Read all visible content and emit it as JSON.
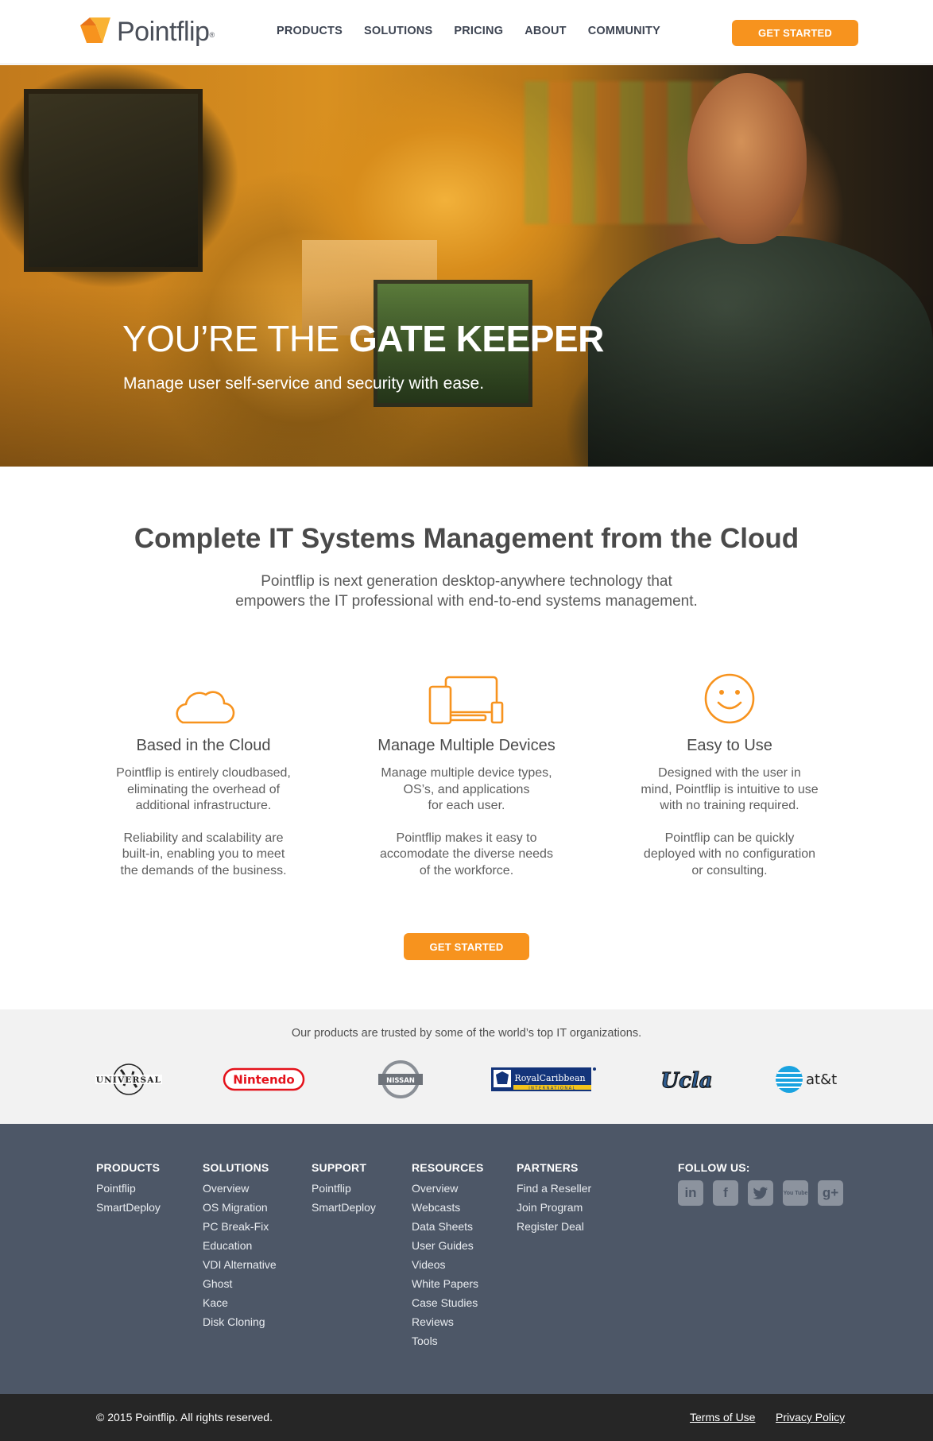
{
  "header": {
    "logo_text": "Pointflip",
    "logo_mark": "®",
    "nav": [
      "PRODUCTS",
      "SOLUTIONS",
      "PRICING",
      "ABOUT",
      "COMMUNITY"
    ],
    "cta": "GET STARTED"
  },
  "hero": {
    "title_light": "YOU’RE THE ",
    "title_bold": "GATE KEEPER",
    "subtitle": "Manage user self-service and security with ease."
  },
  "intro": {
    "title": "Complete IT Systems Management from the Cloud",
    "text_line1": "Pointflip is next generation desktop-anywhere technology that",
    "text_line2": "empowers the IT professional with end-to-end systems management."
  },
  "features": [
    {
      "icon": "cloud-icon",
      "title": "Based in the Cloud",
      "p1": [
        "Pointflip is entirely cloudbased,",
        "eliminating the overhead of",
        "additional infrastructure."
      ],
      "p2": [
        "Reliability and scalability are",
        "built-in, enabling you to meet",
        "the demands of the business."
      ]
    },
    {
      "icon": "devices-icon",
      "title": "Manage Multiple Devices",
      "p1": [
        "Manage multiple device types,",
        "OS’s, and applications",
        "for each user."
      ],
      "p2": [
        "Pointflip makes it easy to",
        "accomodate the diverse needs",
        "of the workforce."
      ]
    },
    {
      "icon": "smiley-icon",
      "title": "Easy to Use",
      "p1": [
        "Designed with the user in",
        "mind, Pointflip is intuitive to use",
        "with no training required."
      ],
      "p2": [
        "Pointflip can be quickly",
        "deployed with no configuration",
        "or consulting."
      ]
    }
  ],
  "cta2": "GET STARTED",
  "trusted": {
    "text": "Our products are trusted by some of the world’s top IT organizations.",
    "logos": [
      "UNIVERSAL",
      "Nintendo",
      "NISSAN",
      "RoyalCaribbean",
      "INTERNATIONAL",
      "Ucla",
      "at&t"
    ]
  },
  "footer": {
    "columns": [
      {
        "title": "PRODUCTS",
        "links": [
          "Pointflip",
          "SmartDeploy"
        ]
      },
      {
        "title": "SOLUTIONS",
        "links": [
          "Overview",
          "OS Migration",
          "PC Break-Fix",
          "Education",
          "VDI Alternative",
          "Ghost",
          "Kace",
          "Disk Cloning"
        ]
      },
      {
        "title": "SUPPORT",
        "links": [
          "Pointflip",
          "SmartDeploy"
        ]
      },
      {
        "title": "RESOURCES",
        "links": [
          "Overview",
          "Webcasts",
          "Data Sheets",
          "User Guides",
          "Videos",
          "White Papers",
          "Case Studies",
          "Reviews",
          "Tools"
        ]
      },
      {
        "title": "PARTNERS",
        "links": [
          "Find a Reseller",
          "Join Program",
          "Register Deal"
        ]
      }
    ],
    "follow_title": "FOLLOW US:",
    "social": [
      {
        "icon": "linkedin-icon",
        "glyph": "in"
      },
      {
        "icon": "facebook-icon",
        "glyph": "f"
      },
      {
        "icon": "twitter-icon",
        "glyph": "t"
      },
      {
        "icon": "youtube-icon",
        "glyph": "You Tube"
      },
      {
        "icon": "googleplus-icon",
        "glyph": "g+"
      }
    ],
    "copyright": "© 2015 Pointflip.  All rights reserved.",
    "terms": "Terms of Use",
    "privacy": "Privacy Policy"
  },
  "colors": {
    "accent": "#f7931e",
    "footer_bg": "#4d5767",
    "bottom_bar": "#262626",
    "trusted_bg": "#f2f2f2"
  }
}
